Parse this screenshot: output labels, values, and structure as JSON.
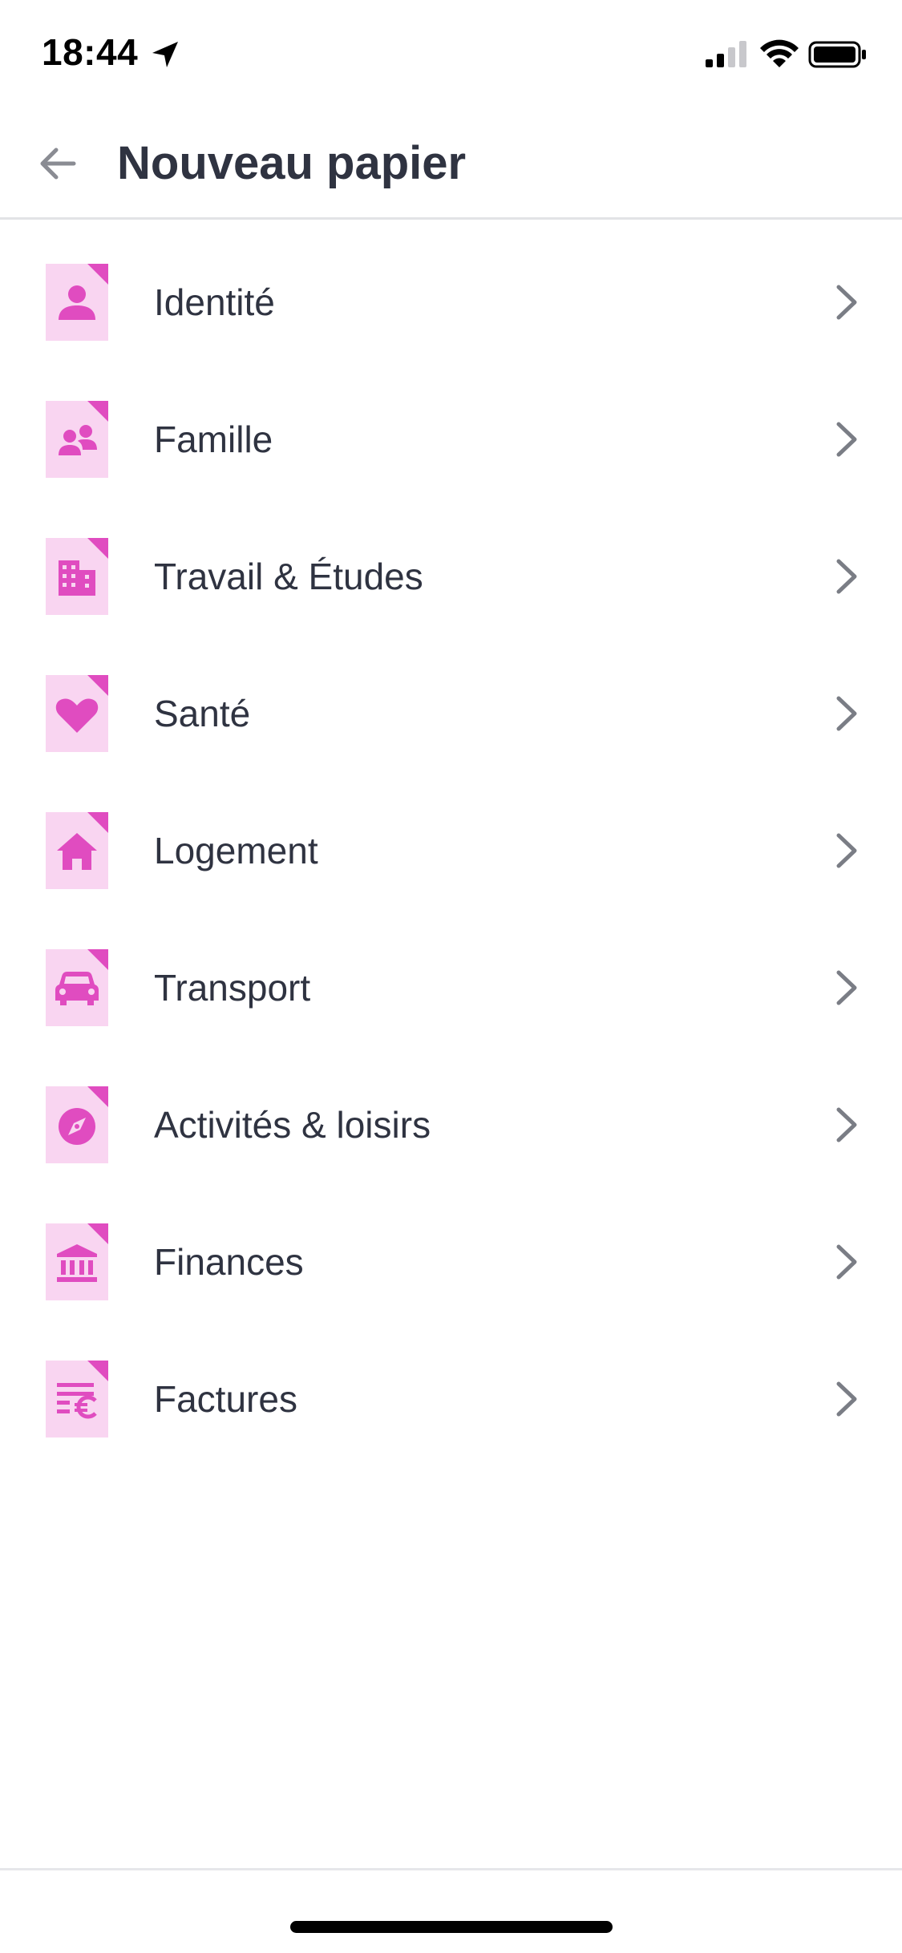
{
  "status_bar": {
    "time": "18:44"
  },
  "header": {
    "title": "Nouveau papier",
    "back_icon": "arrow-left-icon"
  },
  "colors": {
    "accent": "#e04cc0",
    "icon_background": "#f9d5f1",
    "text": "#2f3341",
    "chevron": "#7a7d85",
    "divider": "#e2e3e6"
  },
  "categories": [
    {
      "label": "Identité",
      "icon": "person-icon"
    },
    {
      "label": "Famille",
      "icon": "family-icon"
    },
    {
      "label": "Travail & Études",
      "icon": "building-icon"
    },
    {
      "label": "Santé",
      "icon": "heart-icon"
    },
    {
      "label": "Logement",
      "icon": "house-icon"
    },
    {
      "label": "Transport",
      "icon": "car-icon"
    },
    {
      "label": "Activités & loisirs",
      "icon": "compass-icon"
    },
    {
      "label": "Finances",
      "icon": "bank-icon"
    },
    {
      "label": "Factures",
      "icon": "bill-icon"
    }
  ]
}
